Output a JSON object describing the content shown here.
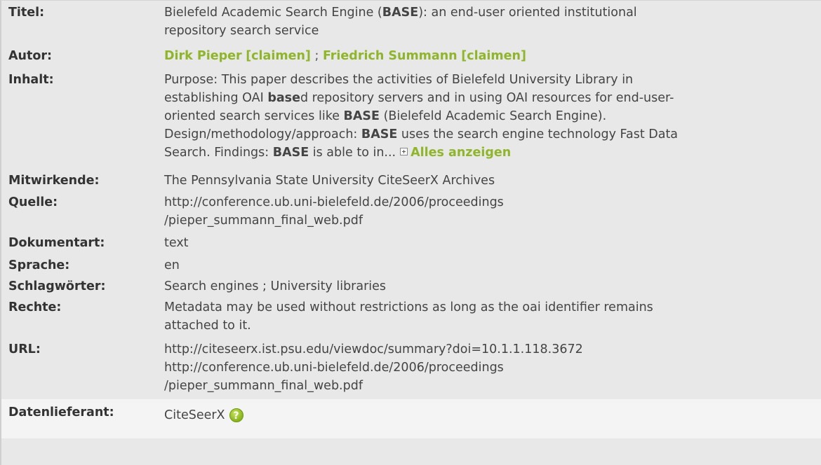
{
  "record": {
    "titel": {
      "label": "Titel:",
      "line1_a": "Bielefeld Academic Search Engine (",
      "line1_b": "BASE",
      "line1_c": "): an end-user oriented institutional",
      "line2": "repository search service"
    },
    "autor": {
      "label": "Autor:",
      "author1": "Dirk Pieper",
      "claim1": "[claimen]",
      "separator": " ; ",
      "author2": "Friedrich Summann",
      "claim2": "[claimen]"
    },
    "inhalt": {
      "label": "Inhalt:",
      "line1": "Purpose: This paper describes the activities of Bielefeld University Library in",
      "line2_a": "establishing OAI ",
      "line2_b": "base",
      "line2_c": "d repository servers and in using OAI resources for end-user-",
      "line3_a": "oriented search services like ",
      "line3_b": "BASE",
      "line3_c": " (Bielefeld Academic Search Engine).",
      "line4_a": "Design/methodology/approach: ",
      "line4_b": "BASE",
      "line4_c": " uses the search engine technology Fast Data",
      "line5_a": "Search. Findings: ",
      "line5_b": "BASE",
      "line5_c": " is able to in...",
      "more_label": "Alles anzeigen"
    },
    "mitwirkende": {
      "label": "Mitwirkende:",
      "value": "The Pennsylvania State University CiteSeerX Archives"
    },
    "quelle": {
      "label": "Quelle:",
      "line1": "http://conference.ub.uni-bielefeld.de/2006/proceedings",
      "line2": "/pieper_summann_final_web.pdf"
    },
    "dokumentart": {
      "label": "Dokumentart:",
      "value": "text"
    },
    "sprache": {
      "label": "Sprache:",
      "value": "en"
    },
    "schlagwoerter": {
      "label": "Schlagwörter:",
      "value": "Search engines ; University libraries"
    },
    "rechte": {
      "label": "Rechte:",
      "line1": "Metadata may be used without restrictions as long as the oai identifier remains",
      "line2": "attached to it."
    },
    "url": {
      "label": "URL:",
      "line1": "http://citeseerx.ist.psu.edu/viewdoc/summary?doi=10.1.1.118.3672",
      "line2": "http://conference.ub.uni-bielefeld.de/2006/proceedings",
      "line3": "/pieper_summann_final_web.pdf"
    },
    "datenlieferant": {
      "label": "Datenlieferant:",
      "value": "CiteSeerX",
      "help_glyph": "?"
    }
  },
  "colors": {
    "link_green": "#8fb62a",
    "background": "#e8e8e8",
    "footer_row": "#f4f4f4"
  },
  "icons": [
    "plus-box-icon",
    "help-icon"
  ]
}
